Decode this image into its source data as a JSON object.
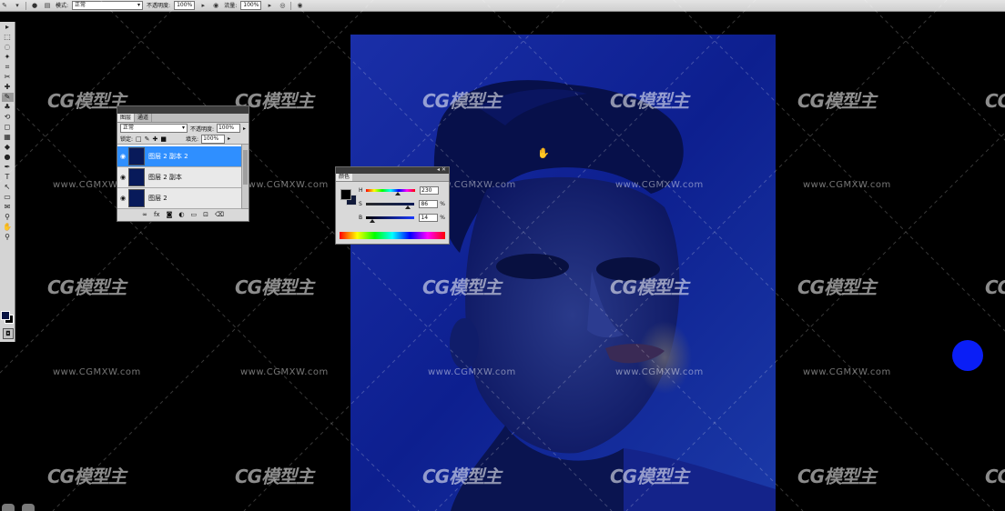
{
  "options_bar": {
    "mode_label": "模式:",
    "mode_value": "正常",
    "opacity_label": "不透明度:",
    "opacity_value": "100%",
    "flow_label": "流量:",
    "flow_value": "100%"
  },
  "toolbox": {
    "tools": [
      "move-tool",
      "marquee-tool",
      "lasso-tool",
      "magic-wand-tool",
      "crop-tool",
      "slice-tool",
      "healing-brush-tool",
      "brush-tool",
      "clone-stamp-tool",
      "history-brush-tool",
      "eraser-tool",
      "gradient-tool",
      "blur-tool",
      "dodge-tool",
      "pen-tool",
      "type-tool",
      "path-selection-tool",
      "shape-tool",
      "notes-tool",
      "eyedropper-tool",
      "hand-tool",
      "zoom-tool"
    ],
    "tool_glyphs": [
      "▸",
      "⬚",
      "◌",
      "✦",
      "⌗",
      "✂",
      "✚",
      "✎",
      "♣",
      "⟲",
      "◻",
      "▦",
      "◆",
      "●",
      "✒",
      "T",
      "↖",
      "▭",
      "✉",
      "⚲",
      "✋",
      "⚲"
    ],
    "foreground_color": "#0a1545",
    "background_color": "#000000"
  },
  "layers_panel": {
    "tabs": [
      "图层",
      "通道"
    ],
    "blend_mode": "正常",
    "opacity_label": "不透明度:",
    "opacity_value": "100%",
    "lock_label": "锁定:",
    "fill_label": "填充:",
    "fill_value": "100%",
    "layers": [
      {
        "name": "图层 2 副本 2",
        "selected": true
      },
      {
        "name": "图层 2 副本",
        "selected": false
      },
      {
        "name": "图层 2",
        "selected": false
      }
    ],
    "bottom_icons": [
      "link-icon",
      "fx-icon",
      "mask-icon",
      "adjustment-icon",
      "group-icon",
      "new-layer-icon",
      "trash-icon"
    ]
  },
  "color_panel": {
    "tab": "颜色",
    "rows": [
      {
        "label": "H",
        "value": "230",
        "unit": "",
        "knob": 0.64
      },
      {
        "label": "S",
        "value": "86",
        "unit": "%",
        "knob": 0.86
      },
      {
        "label": "B",
        "value": "14",
        "unit": "%",
        "knob": 0.14
      }
    ]
  },
  "watermark": {
    "logo": "CG模型主",
    "url": "www.CGMXW.com"
  },
  "colors": {
    "canvas_blue": "#0b1e8a",
    "brush_dot": "#0a1ef6",
    "selected_layer": "#2f8fff"
  }
}
